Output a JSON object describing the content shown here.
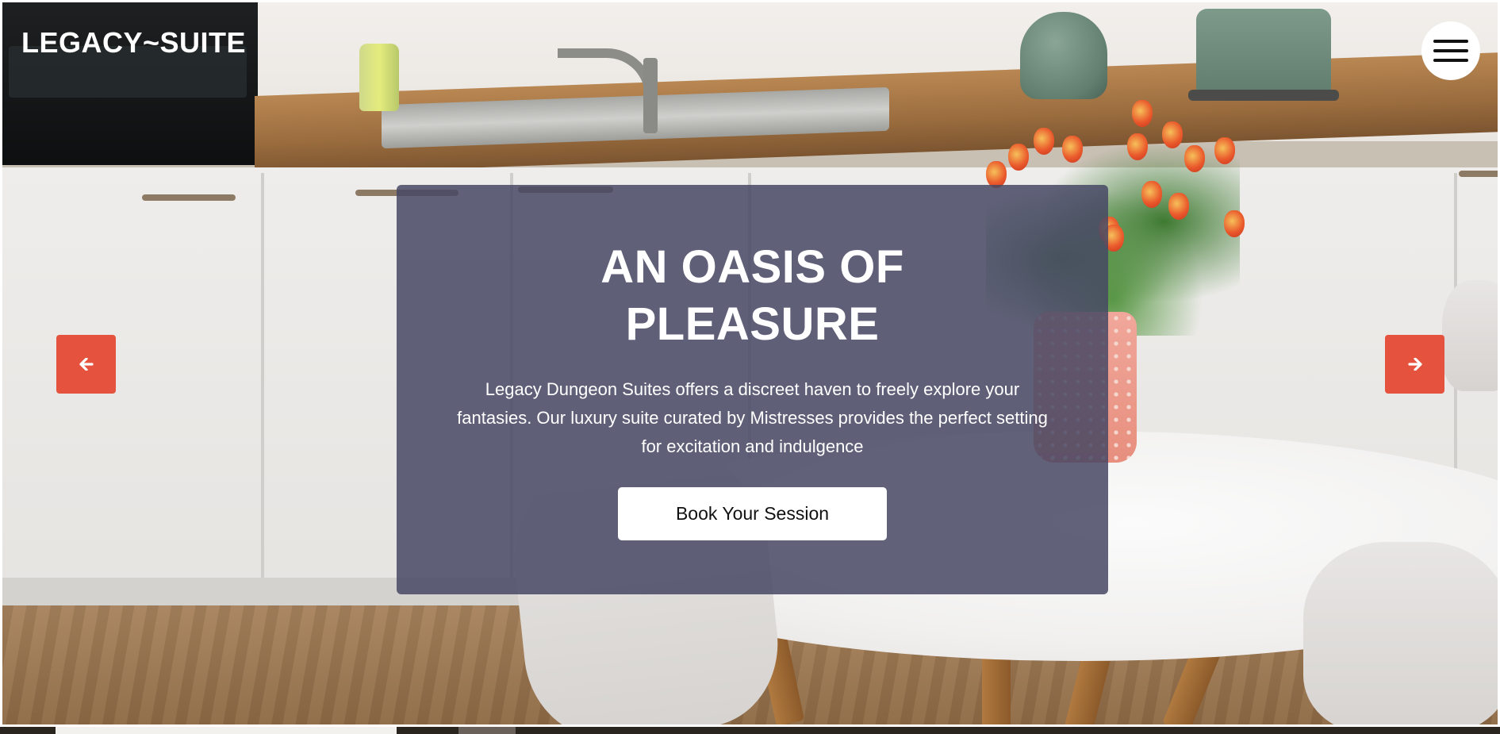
{
  "header": {
    "logo_text": "LEGACY~SUITE",
    "menu_icon": "hamburger-menu-icon"
  },
  "hero": {
    "title_line1": "AN OASIS OF",
    "title_line2": "PLEASURE",
    "description": "Legacy Dungeon Suites offers a discreet haven to freely explore your fantasies. Our luxury suite curated by Mistresses provides the perfect setting for excitation and indulgence",
    "cta_label": "Book Your Session",
    "background_image": "kitchen-with-tulips"
  },
  "carousel": {
    "prev_icon": "arrow-left-icon",
    "next_icon": "arrow-right-icon"
  },
  "colors": {
    "card_overlay": "#464864",
    "arrow_accent": "#e5533f",
    "cta_background": "#ffffff",
    "text_light": "#ffffff"
  }
}
